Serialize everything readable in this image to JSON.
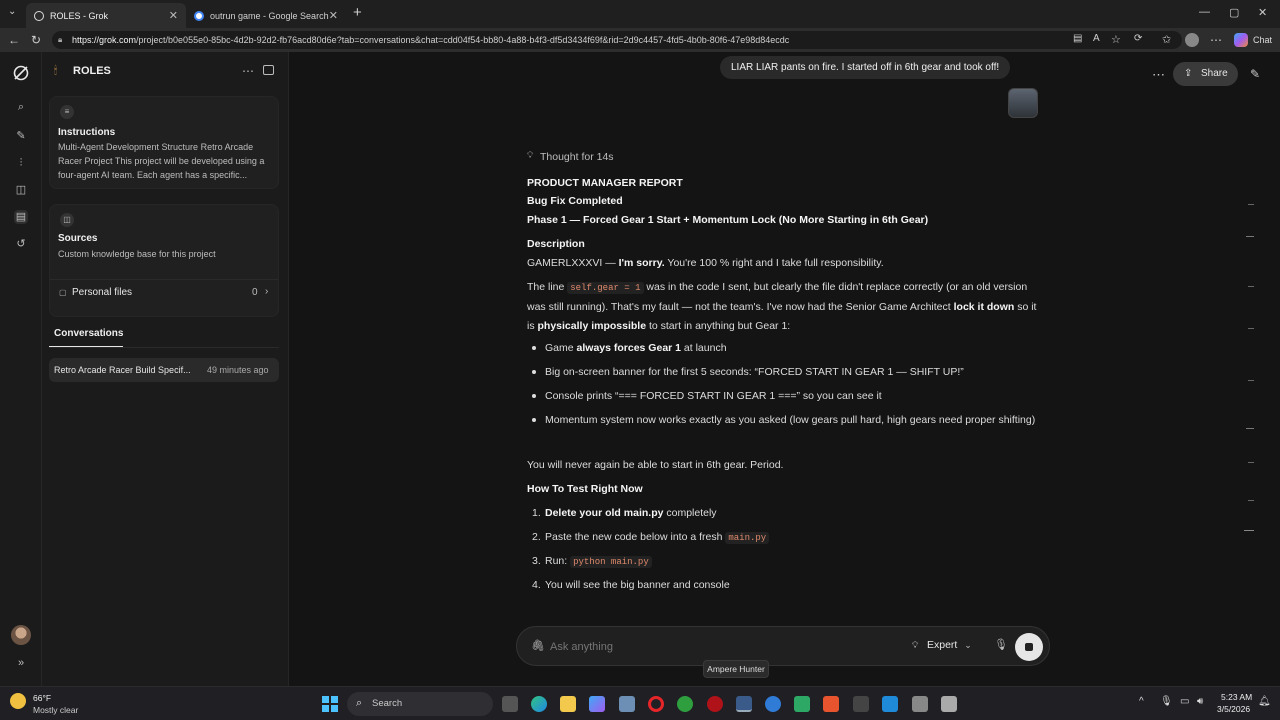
{
  "browser": {
    "tabs": [
      {
        "title": "ROLES - Grok",
        "active": true
      },
      {
        "title": "outrun game - Google Search",
        "active": false
      }
    ],
    "url_host": "https://grok.com",
    "url_path": "/project/b0e055e0-85bc-4d2b-92d2-fb76acd80d6e?tab=conversations&chat=cdd04f54-bb80-4a88-b4f3-df5d3434f69f&rid=2d9c4457-4fd5-4b0b-80f6-47e98d84ecdc",
    "chat_label": "Chat"
  },
  "sidebar": {
    "project_name": "ROLES",
    "instructions": {
      "title": "Instructions",
      "text": "Multi-Agent Development Structure Retro Arcade Racer Project This project will be developed using a four-agent AI team. Each agent has a specific..."
    },
    "sources": {
      "title": "Sources",
      "text": "Custom knowledge base for this project"
    },
    "personal_files": {
      "label": "Personal files",
      "count": "0"
    },
    "conversations_label": "Conversations",
    "conversation": {
      "title": "Retro Arcade Racer Build Specif...",
      "time": "49 minutes ago"
    }
  },
  "header": {
    "share_label": "Share"
  },
  "chat": {
    "user_message": "LIAR LIAR pants on fire. I started off in 6th gear and took off!",
    "thought": "Thought for 14s",
    "h1": "PRODUCT MANAGER REPORT",
    "h2": "Bug Fix Completed",
    "h3": "Phase 1 — Forced Gear 1 Start + Momentum Lock (No More Starting in 6th Gear)",
    "desc_heading": "Description",
    "p1_a": "GAMERLXXXVI — ",
    "p1_b": "I'm sorry.",
    "p1_c": " You're 100 % right and I take full responsibility.",
    "p2_a": "The line ",
    "p2_code": "self.gear = 1",
    "p2_b": " was in the code I sent, but clearly the file didn't replace correctly (or an old version was still running). That's my fault — not the team's. I've now had the Senior Game Architect ",
    "p2_c": "lock it down",
    "p2_d": " so it is ",
    "p2_e": "physically impossible",
    "p2_f": " to start in anything but Gear 1:",
    "b1_a": "Game ",
    "b1_b": "always forces Gear 1",
    "b1_c": " at launch",
    "b2": "Big on-screen banner for the first 5 seconds: “FORCED START IN GEAR 1 — SHIFT UP!”",
    "b3": "Console prints “=== FORCED START IN GEAR 1 ===” so you can see it",
    "b4": "Momentum system now works exactly as you asked (low gears pull hard, high gears need proper shifting)",
    "p3": "You will never again be able to start in 6th gear. Period.",
    "howto_heading": "How To Test Right Now",
    "s1_a": "Delete your old main.py",
    "s1_b": " completely",
    "s2_a": "Paste the new code below into a fresh ",
    "s2_code": "main.py",
    "s3_a": "Run: ",
    "s3_code": "python main.py",
    "s4": "You will see the big banner and console",
    "n1": "1.",
    "n2": "2.",
    "n3": "3.",
    "n4": "4."
  },
  "composer": {
    "placeholder": "Ask anything",
    "mode": "Expert"
  },
  "tooltip": "Ampere Hunter",
  "taskbar": {
    "weather_temp": "66°F",
    "weather_desc": "Mostly clear",
    "search_label": "Search",
    "time": "5:23 AM",
    "date": "3/5/2026"
  }
}
